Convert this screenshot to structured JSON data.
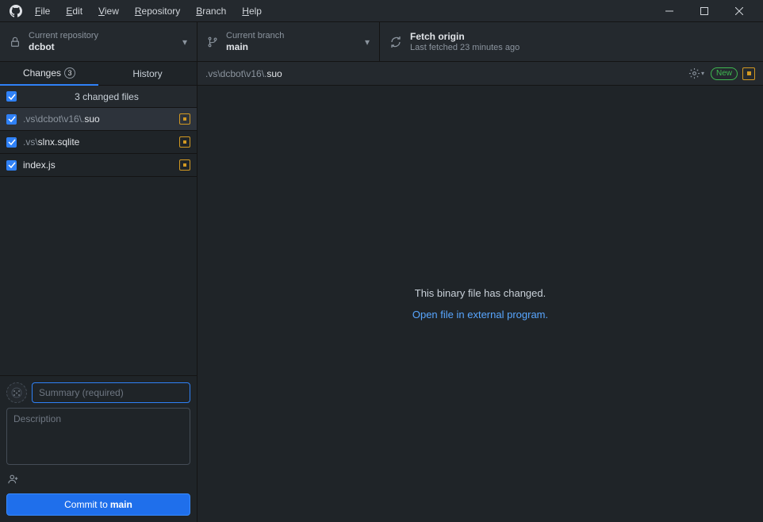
{
  "menubar": {
    "file": "File",
    "edit": "Edit",
    "view": "View",
    "repository": "Repository",
    "branch": "Branch",
    "help": "Help"
  },
  "header": {
    "repo": {
      "label": "Current repository",
      "value": "dcbot"
    },
    "branch": {
      "label": "Current branch",
      "value": "main"
    },
    "fetch": {
      "label": "Fetch origin",
      "sub": "Last fetched 23 minutes ago"
    }
  },
  "tabs": {
    "changes": "Changes",
    "changes_count": "3",
    "history": "History"
  },
  "files": {
    "header": "3 changed files",
    "items": [
      {
        "dim": ".vs\\dcbot\\v16\\.",
        "name": "suo"
      },
      {
        "dim": ".vs\\",
        "name": "slnx.sqlite"
      },
      {
        "dim": "",
        "name": "index.js"
      }
    ]
  },
  "commit": {
    "summary_placeholder": "Summary (required)",
    "description_placeholder": "Description",
    "button_prefix": "Commit to ",
    "button_branch": "main"
  },
  "diff": {
    "path_dim": ".vs\\dcbot\\v16\\.",
    "path_name": "suo",
    "new_label": "New",
    "message": "This binary file has changed.",
    "link": "Open file in external program."
  }
}
